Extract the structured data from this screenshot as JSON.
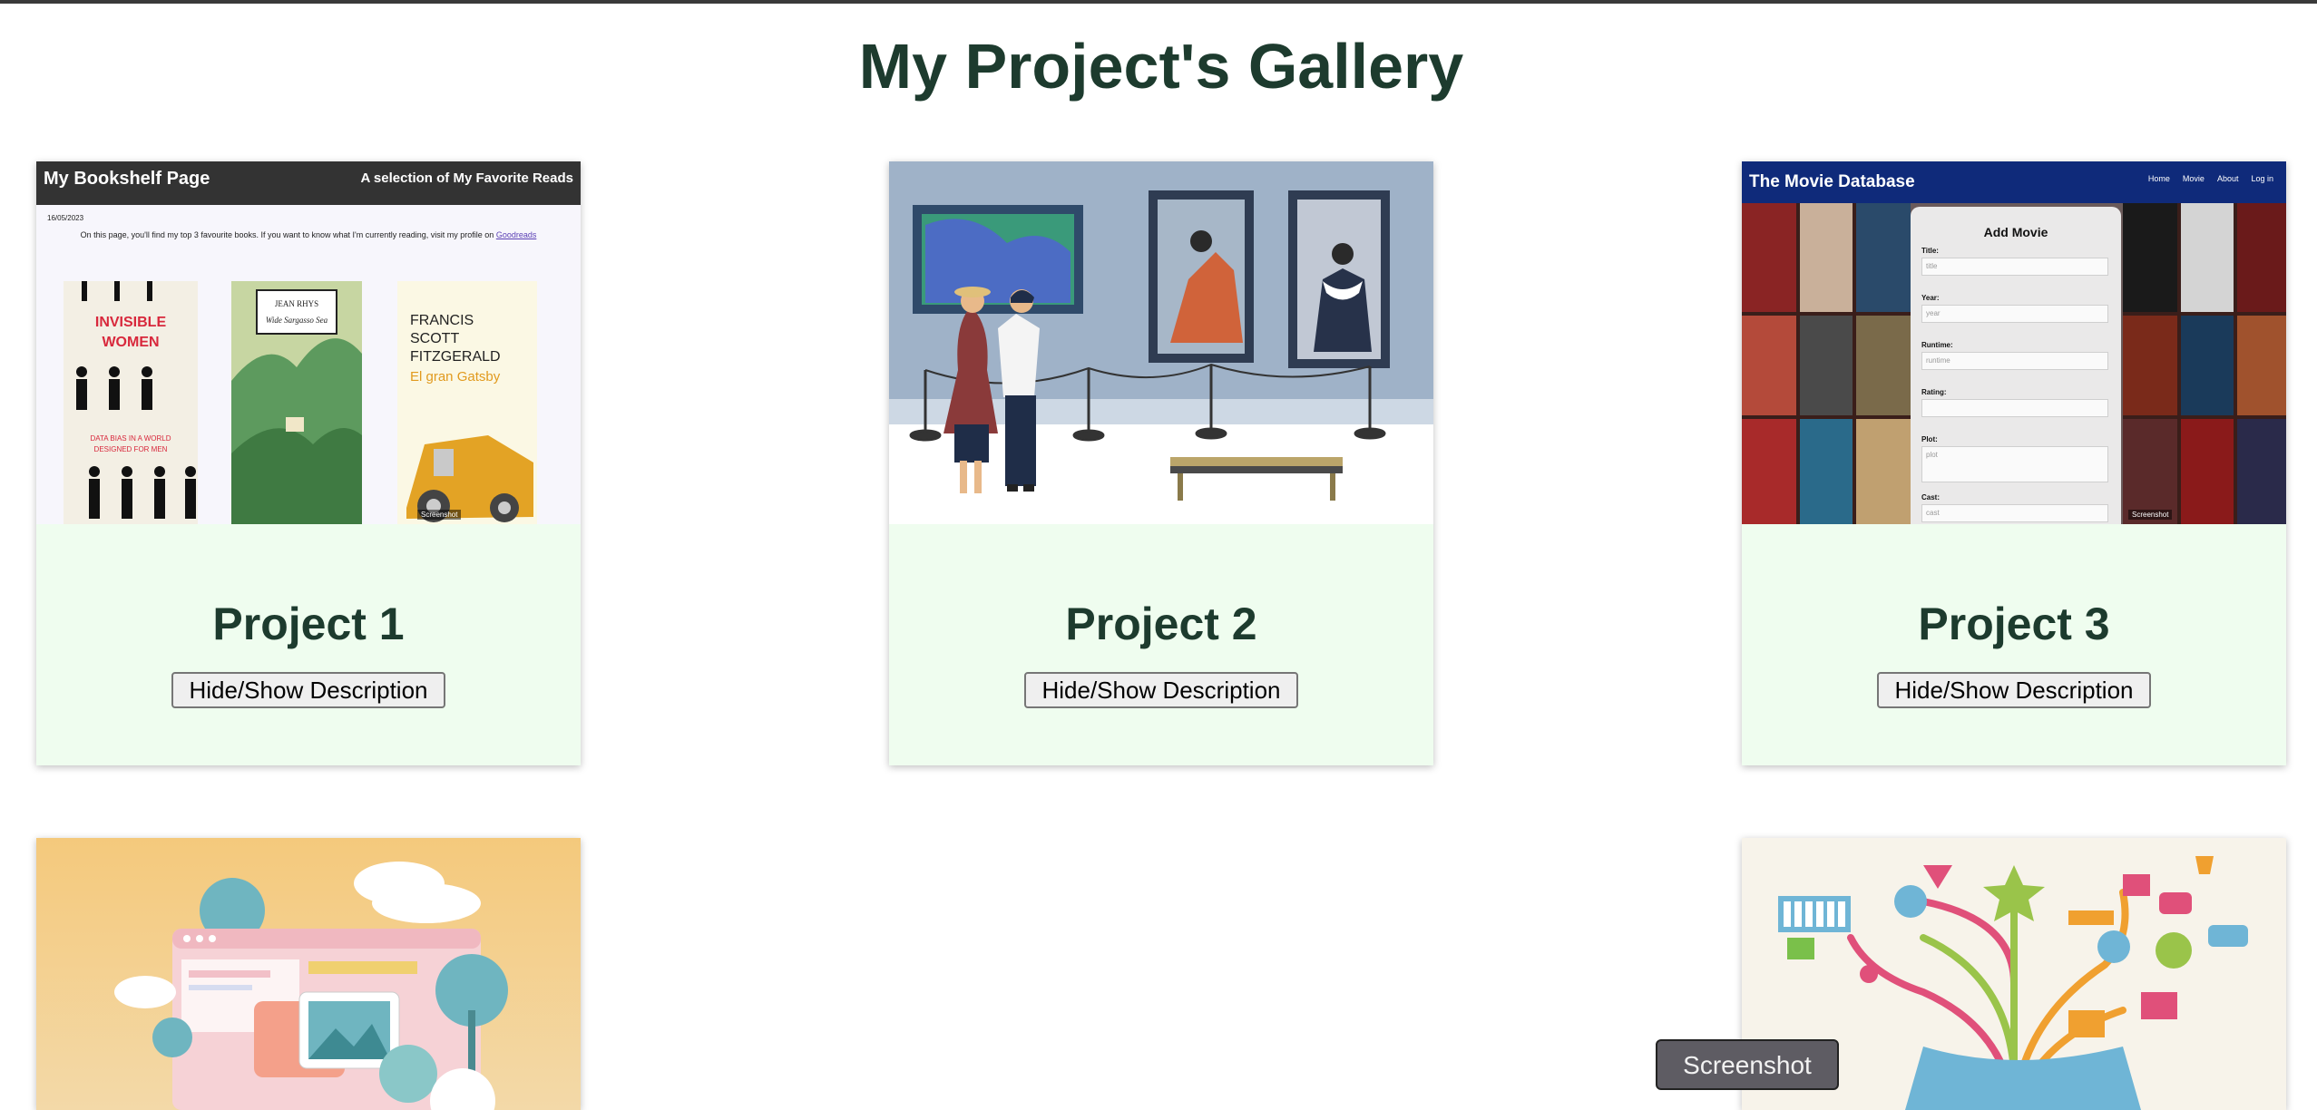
{
  "page": {
    "title": "My Project's Gallery"
  },
  "projects": [
    {
      "title": "Project 1",
      "button_label": "Hide/Show Description"
    },
    {
      "title": "Project 2",
      "button_label": "Hide/Show Description"
    },
    {
      "title": "Project 3",
      "button_label": "Hide/Show Description"
    }
  ],
  "thumb_bookshelf": {
    "header_left": "My Bookshelf Page",
    "header_right": "A selection of My Favorite Reads",
    "date": "16/05/2023",
    "intro": "On this page, you'll find my top 3 favourite books. If you want to know what I'm currently reading, visit my profile on",
    "link": "Goodreads",
    "book1_title": "INVISIBLE WOMEN",
    "book1_sub": "DATA BIAS IN A WORLD DESIGNED FOR MEN",
    "book2_author": "JEAN RHYS",
    "book2_title": "Wide Sargasso Sea",
    "book3_author": "FRANCIS SCOTT FITZGERALD",
    "book3_title": "El gran Gatsby",
    "tag": "Screenshot"
  },
  "thumb_movie": {
    "header": "The Movie Database",
    "nav": [
      "Home",
      "Movie",
      "About",
      "Log in"
    ],
    "form_title": "Add Movie",
    "fields": [
      {
        "label": "Title:",
        "placeholder": "title"
      },
      {
        "label": "Year:",
        "placeholder": "year"
      },
      {
        "label": "Runtime:",
        "placeholder": "runtime"
      },
      {
        "label": "Rating:",
        "placeholder": ""
      },
      {
        "label": "Plot:",
        "placeholder": "plot"
      },
      {
        "label": "Cast:",
        "placeholder": "cast"
      }
    ],
    "tag": "Screenshot"
  },
  "overlay": {
    "screenshot_label": "Screenshot"
  }
}
